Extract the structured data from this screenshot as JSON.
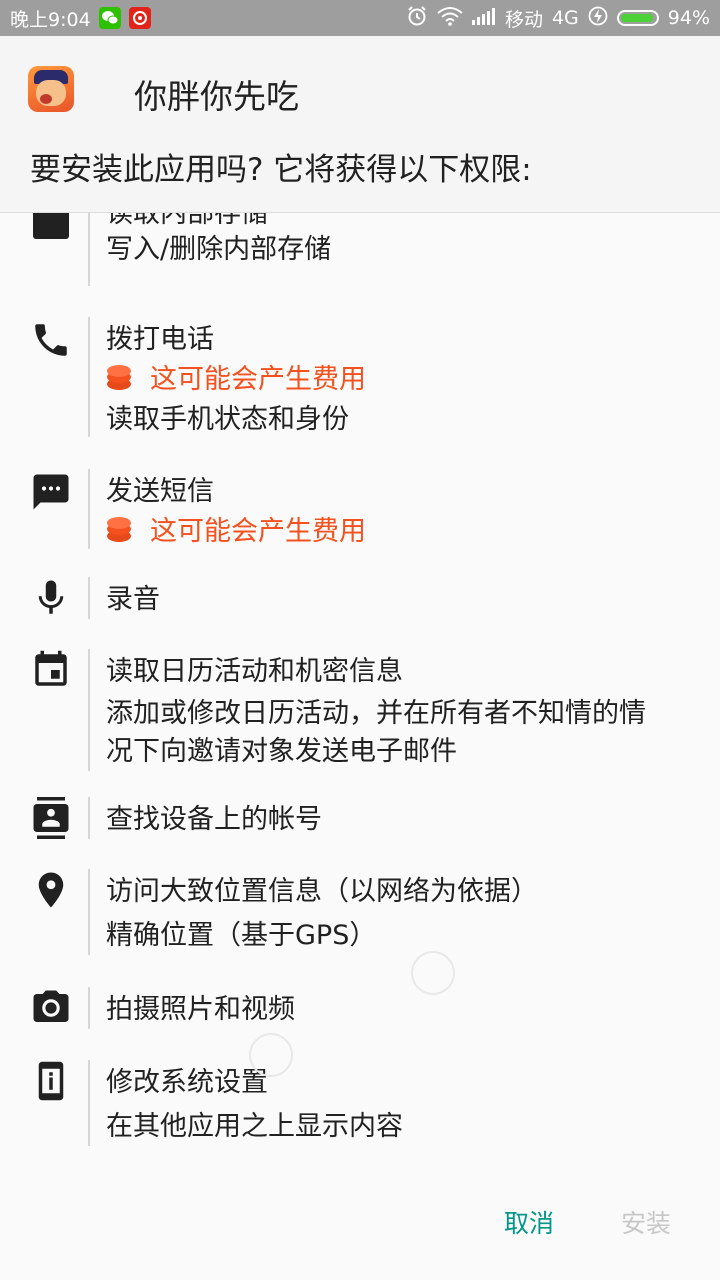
{
  "status_bar": {
    "time": "晚上9:04",
    "carrier": "移动",
    "network": "4G",
    "battery": "94%",
    "battery_level": 0.94,
    "icons": [
      "wechat-icon",
      "netease-music-icon",
      "alarm-icon",
      "wifi-icon",
      "signal-icon",
      "charging-icon",
      "battery-icon"
    ]
  },
  "header": {
    "app_name": "你胖你先吃",
    "prompt": "要安装此应用吗? 它将获得以下权限:"
  },
  "permissions": [
    {
      "icon": "storage-icon",
      "items": [
        "读取内部存储",
        "写入/删除内部存储"
      ]
    },
    {
      "icon": "phone-icon",
      "items": [
        "拨打电话",
        "这可能会产生费用",
        "读取手机状态和身份"
      ]
    },
    {
      "icon": "sms-icon",
      "items": [
        "发送短信",
        "这可能会产生费用"
      ]
    },
    {
      "icon": "microphone-icon",
      "items": [
        "录音"
      ]
    },
    {
      "icon": "calendar-icon",
      "items": [
        "读取日历活动和机密信息",
        "添加或修改日历活动，并在所有者不知情的情",
        "况下向邀请对象发送电子邮件"
      ]
    },
    {
      "icon": "contacts-icon",
      "items": [
        "查找设备上的帐号"
      ]
    },
    {
      "icon": "location-icon",
      "items": [
        "访问大致位置信息（以网络为依据）",
        "精确位置（基于GPS）"
      ]
    },
    {
      "icon": "camera-icon",
      "items": [
        "拍摄照片和视频"
      ]
    },
    {
      "icon": "settings-info-icon",
      "items": [
        "修改系统设置",
        "在其他应用之上显示内容"
      ]
    }
  ],
  "buttons": {
    "cancel": "取消",
    "install": "安装"
  },
  "colors": {
    "accent": "#009688",
    "warning": "#f4511e",
    "disabled": "#c7c7c7"
  }
}
